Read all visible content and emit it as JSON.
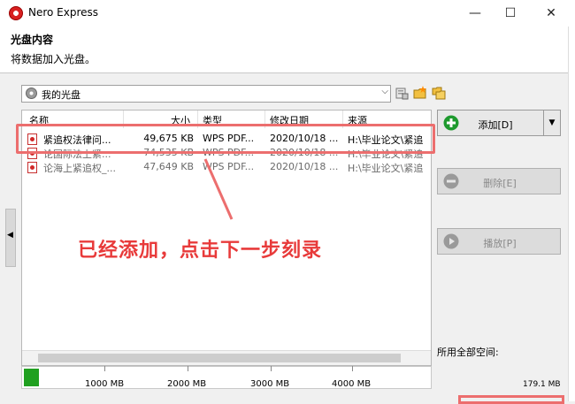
{
  "window": {
    "title": "Nero Express",
    "minimize": "—",
    "maximize": "☐",
    "close": "✕"
  },
  "header": {
    "title": "光盘内容",
    "subtitle": "将数据加入光盘。"
  },
  "disc_selector": {
    "value": "我的光盘",
    "arrow": "⌵"
  },
  "file_list": {
    "columns": [
      "名称",
      "大小",
      "类型",
      "修改日期",
      "来源"
    ],
    "sort_arrow": "^",
    "rows": [
      {
        "name": "紧追权法律问...",
        "size": "49,675 KB",
        "type": "WPS PDF...",
        "date": "2020/10/18 ...",
        "source": "H:\\毕业论文\\紧追"
      },
      {
        "name": "论国际法上紧...",
        "size": "74,535 KB",
        "type": "WPS PDF...",
        "date": "2020/10/18 ...",
        "source": "H:\\毕业论文\\紧追"
      },
      {
        "name": "论海上紧追权_...",
        "size": "47,649 KB",
        "type": "WPS PDF...",
        "date": "2020/10/18 ...",
        "source": "H:\\毕业论文\\紧追"
      }
    ]
  },
  "buttons": {
    "add": "添加[D]",
    "delete": "删除[E]",
    "play": "播放[P]",
    "dropdown_arrow": "▼"
  },
  "space": {
    "label": "所用全部空间:",
    "value": "179.1 MB",
    "used_mb": 179.1,
    "ticks": [
      "1000 MB",
      "2000 MB",
      "3000 MB",
      "4000 MB"
    ]
  },
  "annotation": {
    "text": "已经添加，点击下一步刻录",
    "color": "#e83a3a"
  },
  "colors": {
    "capacity_fill": "#20a020",
    "highlight": "#ec6e6e"
  },
  "side_arrow": "◀"
}
